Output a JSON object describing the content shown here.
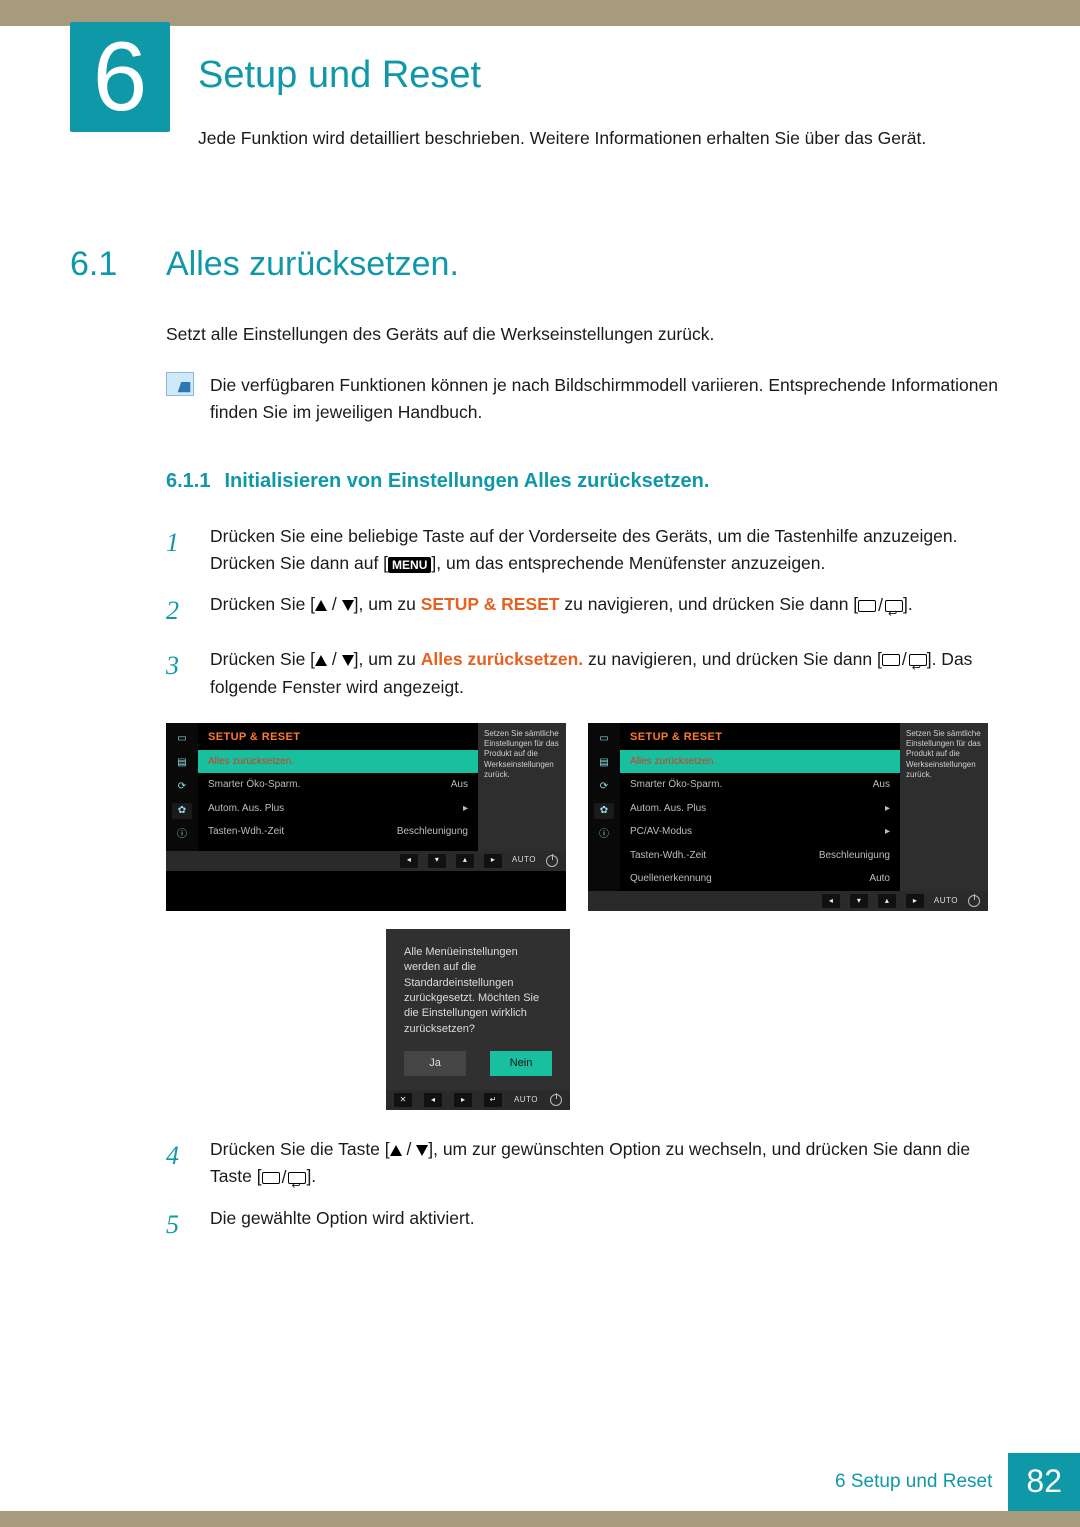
{
  "chapter": {
    "number": "6",
    "title": "Setup und Reset",
    "subtitle": "Jede Funktion wird detailliert beschrieben. Weitere Informationen erhalten Sie über das Gerät."
  },
  "section": {
    "number": "6.1",
    "title": "Alles zurücksetzen.",
    "intro": "Setzt alle Einstellungen des Geräts auf die Werkseinstellungen zurück.",
    "note": "Die verfügbaren Funktionen können je nach Bildschirmmodell variieren. Entsprechende Informationen finden Sie im jeweiligen Handbuch."
  },
  "subsection": {
    "number": "6.1.1",
    "title": "Initialisieren von Einstellungen Alles zurücksetzen."
  },
  "steps": {
    "s1a": "Drücken Sie eine beliebige Taste auf der Vorderseite des Geräts, um die Tastenhilfe anzuzeigen. Drücken Sie dann auf [",
    "s1b": "], um das entsprechende Menüfenster anzuzeigen.",
    "menu_label": "MENU",
    "s2a": "Drücken Sie [",
    "s2b": "], um zu ",
    "s2target": "SETUP & RESET",
    "s2c": " zu navigieren, und drücken Sie dann [",
    "s2d": "].",
    "s3a": "Drücken Sie [",
    "s3b": "], um zu ",
    "s3target": "Alles zurücksetzen.",
    "s3c": " zu navigieren, und drücken Sie dann [",
    "s3d": "]. Das folgende Fenster wird angezeigt.",
    "s4a": "Drücken Sie die Taste [",
    "s4b": "], um zur gewünschten Option zu wechseln, und drücken Sie dann die Taste [",
    "s4c": "].",
    "s5": "Die gewählte Option wird aktiviert."
  },
  "osd": {
    "title": "SETUP & RESET",
    "help": "Setzen Sie sämtliche Einstellungen für das Produkt auf die Werkseinstellungen zurück.",
    "auto": "AUTO",
    "menu1": [
      {
        "label": "Alles zurücksetzen.",
        "val": "",
        "hl": true
      },
      {
        "label": "Smarter Öko-Sparm.",
        "val": "Aus"
      },
      {
        "label": "Autom. Aus. Plus",
        "val": "▸"
      },
      {
        "label": "Tasten-Wdh.-Zeit",
        "val": "Beschleunigung"
      }
    ],
    "menu2": [
      {
        "label": "Alles zurücksetzen.",
        "val": "",
        "hl": true
      },
      {
        "label": "Smarter Öko-Sparm.",
        "val": "Aus"
      },
      {
        "label": "Autom. Aus. Plus",
        "val": "▸"
      },
      {
        "label": "PC/AV-Modus",
        "val": "▸"
      },
      {
        "label": "Tasten-Wdh.-Zeit",
        "val": "Beschleunigung"
      },
      {
        "label": "Quellenerkennung",
        "val": "Auto"
      }
    ]
  },
  "dialog": {
    "question": "Alle Menüeinstellungen werden auf die Standardeinstellungen zurückgesetzt. Möchten Sie die Einstellungen wirklich zurücksetzen?",
    "yes": "Ja",
    "no": "Nein",
    "auto": "AUTO"
  },
  "footer": {
    "label": "6 Setup und Reset",
    "page": "82"
  }
}
